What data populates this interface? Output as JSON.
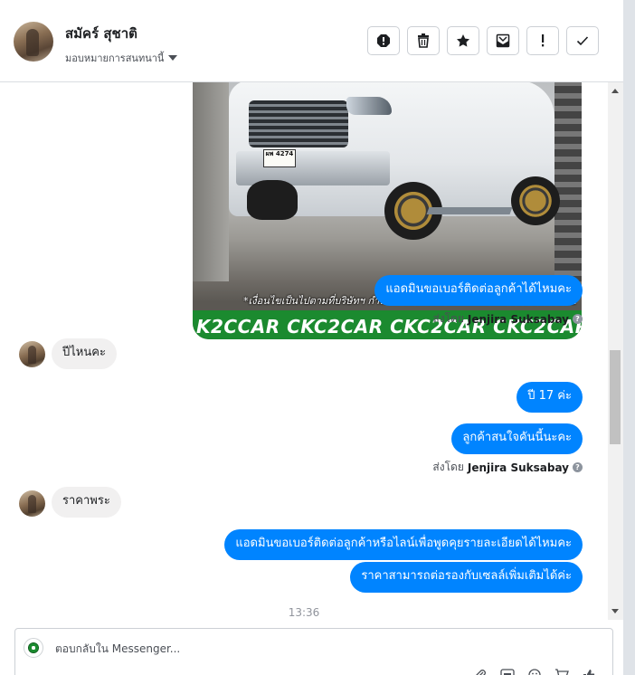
{
  "header": {
    "contact_name": "สมัคร์ สุชาติ",
    "assign_label": "มอบหมายการสนทนานี้",
    "actions": [
      {
        "name": "mark-spam-icon"
      },
      {
        "name": "trash-icon"
      },
      {
        "name": "star-icon"
      },
      {
        "name": "mark-unread-icon"
      },
      {
        "name": "exclamation-icon"
      },
      {
        "name": "check-icon"
      }
    ]
  },
  "thread": {
    "image": {
      "caption": "*เงื่อนไขเป็นไปตามที่บริษัทฯ กำหนด โทรสอบถามเพิ่มเติมได้ที่ 088-5577932",
      "band_text": "K2CCAR CKC2CAR CKC2CAR CKC2CAR CKC2",
      "plate_text": "ผพ 4274"
    },
    "messages": [
      {
        "text": "แอดมินขอเบอร์ติดต่อลูกค้าได้ไหมคะ",
        "direction": "out"
      },
      {
        "text": "ปีไหนคะ",
        "direction": "in"
      },
      {
        "text": "ปี 17 ค่ะ",
        "direction": "out"
      },
      {
        "text": "ลูกค้าสนใจคันนี้นะคะ",
        "direction": "out"
      },
      {
        "text": "ราคาพระ",
        "direction": "in"
      },
      {
        "text": "แอดมินขอเบอร์ติดต่อลูกค้าหรือไลน์เพื่อพูดคุยรายละเอียดได้ไหมคะ",
        "direction": "out"
      },
      {
        "text": "ราคาสามารถต่อรองกับเซลล์เพิ่มเติมได้ค่ะ",
        "direction": "out"
      }
    ],
    "sent_by_prefix": "ส่งโดย",
    "sent_by_name": "Jenjira Suksabay",
    "timestamp": "13:36"
  },
  "composer": {
    "placeholder": "ตอบกลับใน Messenger...",
    "value": "",
    "tools": [
      "attachment-icon",
      "gif-icon",
      "emoji-icon",
      "cart-icon",
      "like-icon"
    ]
  },
  "colors": {
    "outgoing_bubble": "#0084ff",
    "incoming_bubble": "#f1f0f0",
    "band_green": "#1b8a2f"
  }
}
